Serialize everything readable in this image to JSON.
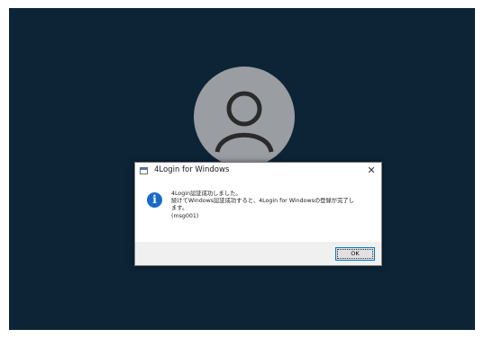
{
  "lock_screen": {
    "background_color": "#0d2436",
    "avatar_icon": "user-silhouette-icon"
  },
  "dialog": {
    "title": "4Login for Windows",
    "app_icon": "window-app-icon",
    "close_label": "✕",
    "info_icon_glyph": "i",
    "message_lines": [
      "4Login認証成功しました。",
      "続けてWindows認証成功すると、4Login for Windowsの登録が完了し",
      "ます。",
      "(msg001)"
    ],
    "ok_label": "OK"
  }
}
